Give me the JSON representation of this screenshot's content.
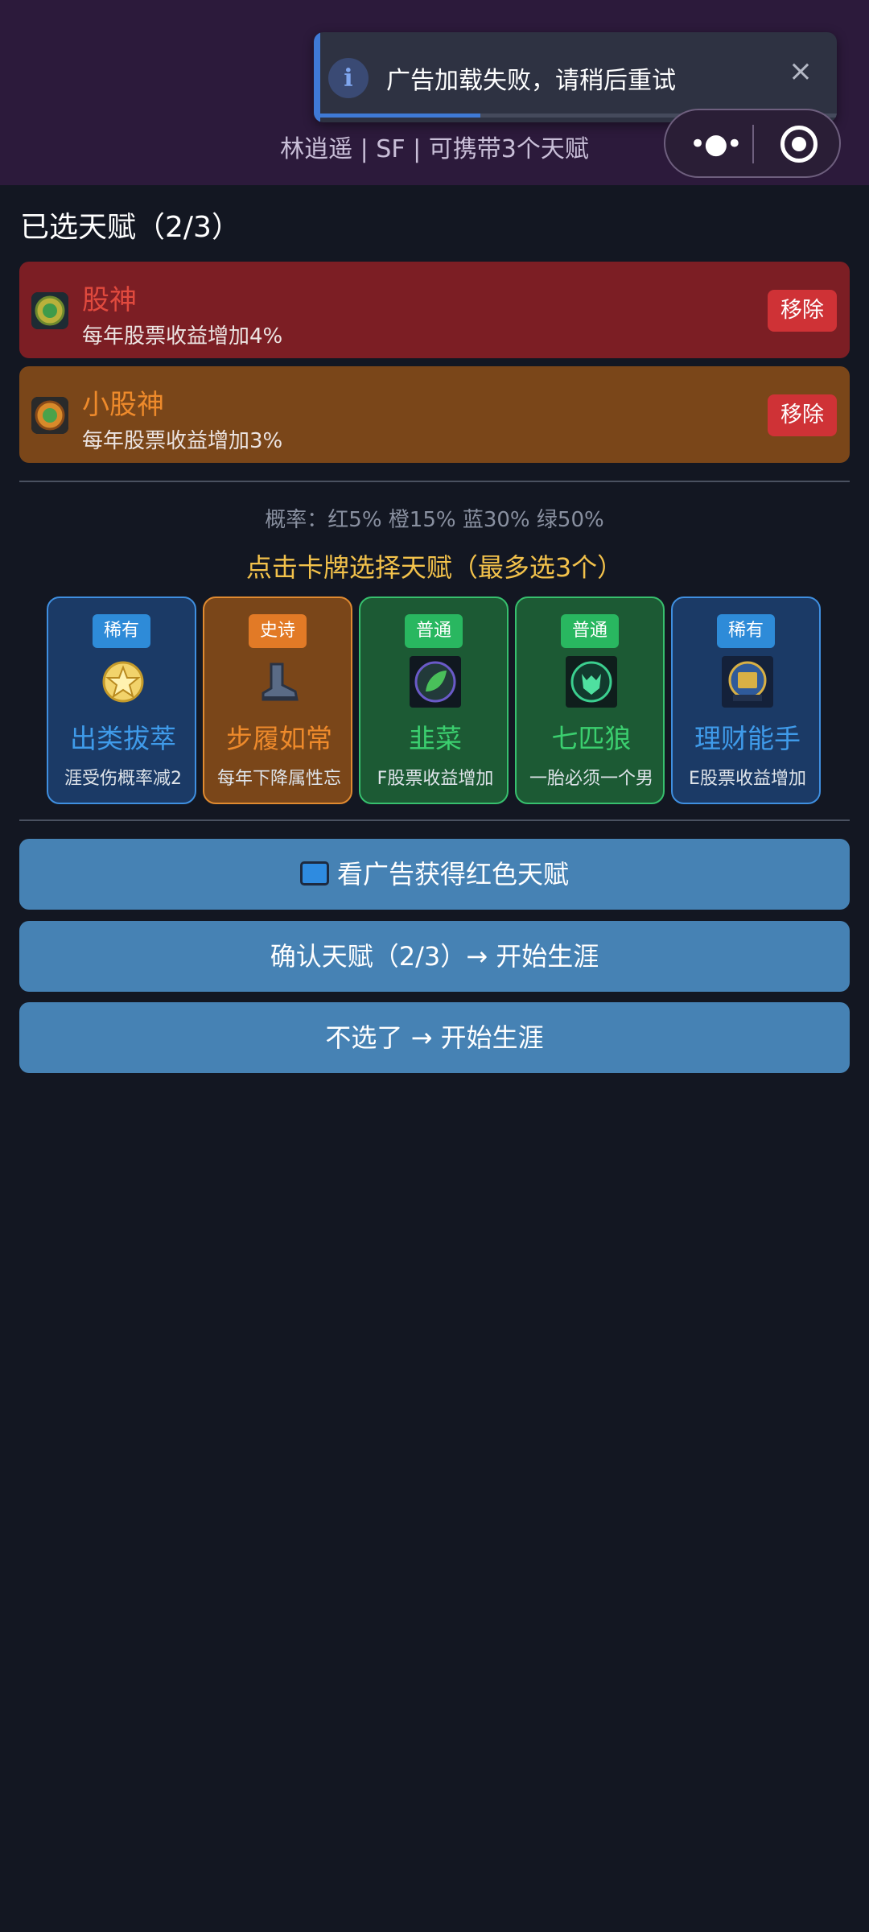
{
  "header": {
    "subtitle": "林逍遥 | SF  |  可携带3个天赋"
  },
  "toast": {
    "message": "广告加载失败，请稍后重试",
    "info_glyph": "i",
    "close_glyph": "×",
    "progress": 0.31
  },
  "capsule": {
    "more_glyph": "•●•"
  },
  "selected": {
    "title": "已选天赋（2/3）",
    "items": [
      {
        "name": "股神",
        "desc": "每年股票收益增加4%",
        "remove_label": "移除",
        "color": "#e14a3e",
        "bg": "#7c1e24",
        "icon": "coin-icon"
      },
      {
        "name": "小股神",
        "desc": "每年股票收益增加3%",
        "remove_label": "移除",
        "color": "#ee8a2b",
        "bg": "#7a4619",
        "icon": "coin-icon"
      }
    ]
  },
  "probability": "概率：红5% 橙15% 蓝30% 绿50%",
  "pick_title": "点击卡牌选择天赋（最多选3个）",
  "cards": [
    {
      "badge": "稀有",
      "name": "出类拔萃",
      "desc": "涯受伤概率减2",
      "rarity": "blue",
      "icon": "star-medal-icon"
    },
    {
      "badge": "史诗",
      "name": "步履如常",
      "desc": "每年下降属性忘",
      "rarity": "orange",
      "icon": "boot-icon"
    },
    {
      "badge": "普通",
      "name": "韭菜",
      "desc": "F股票收益增加",
      "rarity": "green",
      "icon": "leaf-icon"
    },
    {
      "badge": "普通",
      "name": "七匹狼",
      "desc": "一胎必须一个男",
      "rarity": "green",
      "icon": "wolf-icon"
    },
    {
      "badge": "稀有",
      "name": "理财能手",
      "desc": "E股票收益增加",
      "rarity": "blue",
      "icon": "finance-book-icon"
    }
  ],
  "buttons": {
    "watch_ad": "看广告获得红色天赋",
    "confirm": "确认天赋（2/3）→ 开始生涯",
    "skip": "不选了 → 开始生涯"
  },
  "colors": {
    "blue_card_bg": "#1b3a66",
    "blue_card_border": "#3f8fe0",
    "blue_text": "#3f9bea",
    "blue_badge": "#2e8bd8",
    "orange_card_bg": "#7a4619",
    "orange_card_border": "#e08a30",
    "orange_text": "#ee8a2b",
    "orange_badge": "#e27a26",
    "green_card_bg": "#1c5a34",
    "green_card_border": "#37c06e",
    "green_text": "#3bcf6f",
    "green_badge": "#29b760",
    "button_bg": "#4682b4"
  }
}
